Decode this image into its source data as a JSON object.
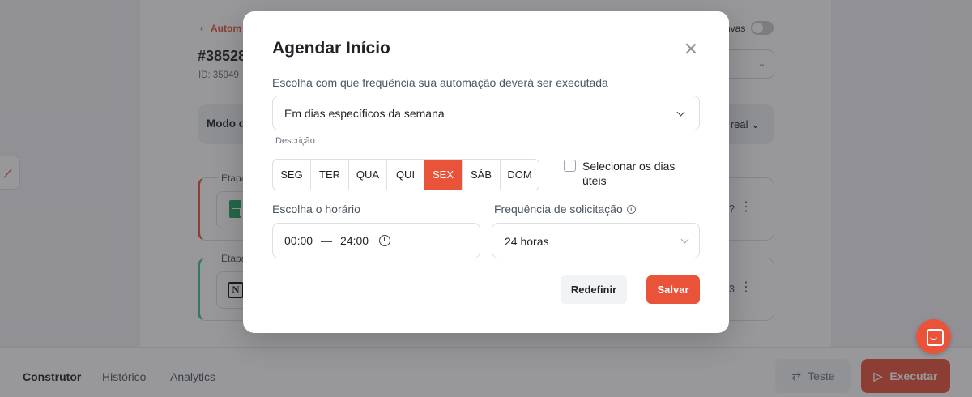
{
  "background": {
    "back_link": "Autom",
    "automation_id": "#38528",
    "id_line": "ID: 35949",
    "canvas_label": "nvas",
    "mode_label": "Modo d",
    "mode_value": "real",
    "steps": [
      {
        "tag": "Etapa",
        "icon": "google-sheets-icon",
        "meta": "?"
      },
      {
        "tag": "Etapa",
        "icon": "notion-icon",
        "meta": "3"
      }
    ]
  },
  "bottom_bar": {
    "tabs": [
      "Construtor",
      "Histórico",
      "Analytics"
    ],
    "active_tab": "Construtor",
    "test_label": "Teste",
    "run_label": "Executar"
  },
  "modal": {
    "title": "Agendar Início",
    "frequency_label": "Escolha com que frequência sua automação deverá ser executada",
    "frequency_value": "Em dias específicos da semana",
    "description_label": "Descrição",
    "days": [
      {
        "label": "SEG",
        "selected": false
      },
      {
        "label": "TER",
        "selected": false
      },
      {
        "label": "QUA",
        "selected": false
      },
      {
        "label": "QUI",
        "selected": false
      },
      {
        "label": "SEX",
        "selected": true
      },
      {
        "label": "SÁB",
        "selected": false
      },
      {
        "label": "DOM",
        "selected": false
      }
    ],
    "business_days_label": "Selecionar os dias úteis",
    "business_days_checked": false,
    "time_label": "Escolha o horário",
    "time_start": "00:00",
    "time_separator": "—",
    "time_end": "24:00",
    "request_freq_label": "Frequência de solicitação",
    "request_freq_value": "24 horas",
    "reset_label": "Redefinir",
    "save_label": "Salvar"
  },
  "colors": {
    "accent": "#e8533a",
    "success": "#3ec48b"
  }
}
